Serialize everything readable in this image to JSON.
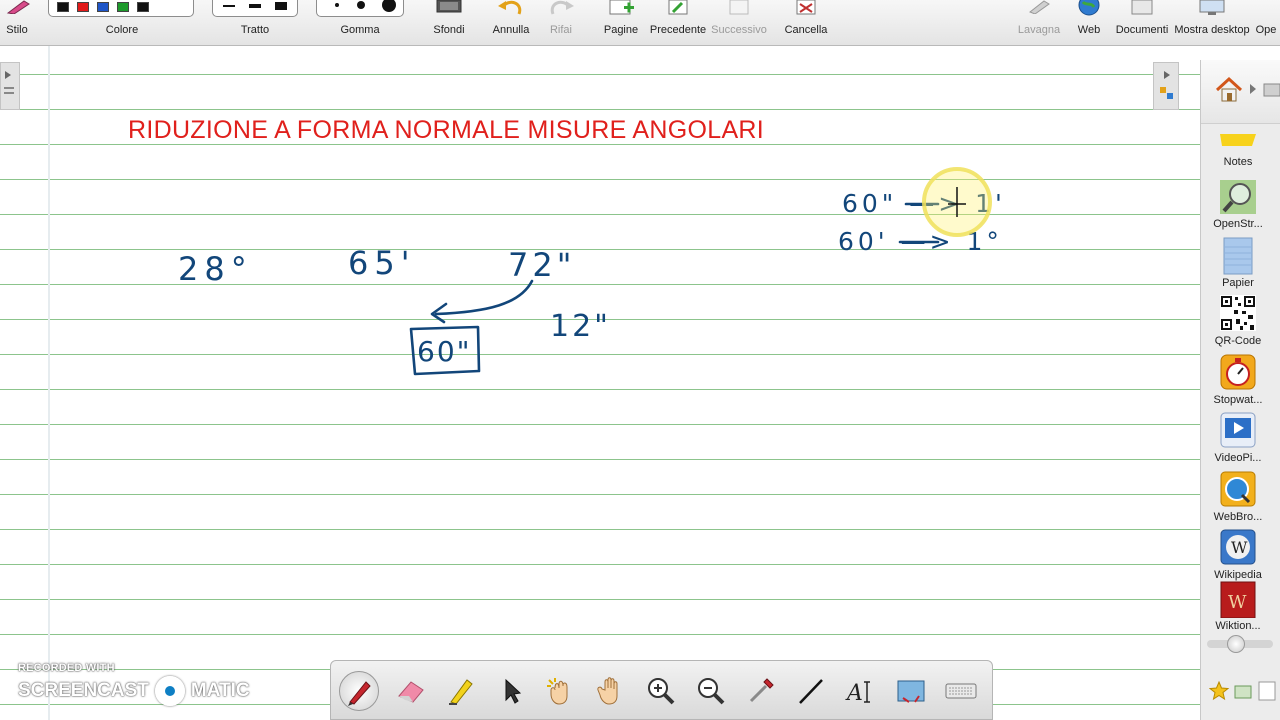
{
  "toolbar": {
    "items": [
      {
        "id": "stilo",
        "label": "Stilo"
      },
      {
        "id": "colore",
        "label": "Colore"
      },
      {
        "id": "tratto",
        "label": "Tratto"
      },
      {
        "id": "gomma",
        "label": "Gomma"
      },
      {
        "id": "sfondi",
        "label": "Sfondi"
      },
      {
        "id": "annulla",
        "label": "Annulla"
      },
      {
        "id": "rifai",
        "label": "Rifai"
      },
      {
        "id": "pagine",
        "label": "Pagine"
      },
      {
        "id": "precedente",
        "label": "Precedente"
      },
      {
        "id": "successivo",
        "label": "Successivo"
      },
      {
        "id": "cancella",
        "label": "Cancella"
      },
      {
        "id": "lavagna",
        "label": "Lavagna"
      },
      {
        "id": "web",
        "label": "Web"
      },
      {
        "id": "documenti",
        "label": "Documenti"
      },
      {
        "id": "mostra",
        "label": "Mostra desktop"
      },
      {
        "id": "ope",
        "label": "Ope"
      }
    ],
    "palette_colors": [
      "#111111",
      "#e21b1b",
      "#1f56c8",
      "#1e9a2c",
      "#111111"
    ]
  },
  "board": {
    "title": "RIDUZIONE A FORMA NORMALE MISURE ANGOLARI",
    "title_color": "#e0201c",
    "ink_color": "#12467a",
    "line_color": "#8cc48c",
    "handwriting": {
      "degrees": "28°",
      "minutes": "65'",
      "seconds": "72\"",
      "carry_box": "60\"",
      "remainder": "12\"",
      "rule_seconds": "60\" —> 1'",
      "rule_minutes": "60' —> 1°"
    }
  },
  "sidebar": {
    "items": [
      {
        "id": "notes",
        "label": "Notes",
        "icon": "sticky-note-icon"
      },
      {
        "id": "openstreet",
        "label": "OpenStr...",
        "icon": "magnifier-map-icon"
      },
      {
        "id": "papier",
        "label": "Papier",
        "icon": "paper-icon"
      },
      {
        "id": "qrcode",
        "label": "QR-Code",
        "icon": "qr-code-icon"
      },
      {
        "id": "stopwatch",
        "label": "Stopwat...",
        "icon": "stopwatch-icon"
      },
      {
        "id": "videopi",
        "label": "VideoPi...",
        "icon": "video-icon"
      },
      {
        "id": "webbrowser",
        "label": "WebBro...",
        "icon": "globe-icon"
      },
      {
        "id": "wikipedia",
        "label": "Wikipedia",
        "icon": "wikipedia-icon"
      },
      {
        "id": "wiktionary",
        "label": "Wiktion...",
        "icon": "wiktionary-icon"
      }
    ]
  },
  "bottombar": {
    "tools": [
      "pen-icon",
      "eraser-icon",
      "highlighter-icon",
      "pointer-icon",
      "magic-hand-icon",
      "hand-icon",
      "zoom-in-icon",
      "zoom-out-icon",
      "color-picker-icon",
      "line-icon",
      "text-icon",
      "screen-capture-icon",
      "keyboard-icon"
    ]
  },
  "watermark": {
    "small": "RECORDED WITH",
    "left": "SCREENCAST",
    "right": "MATIC"
  }
}
